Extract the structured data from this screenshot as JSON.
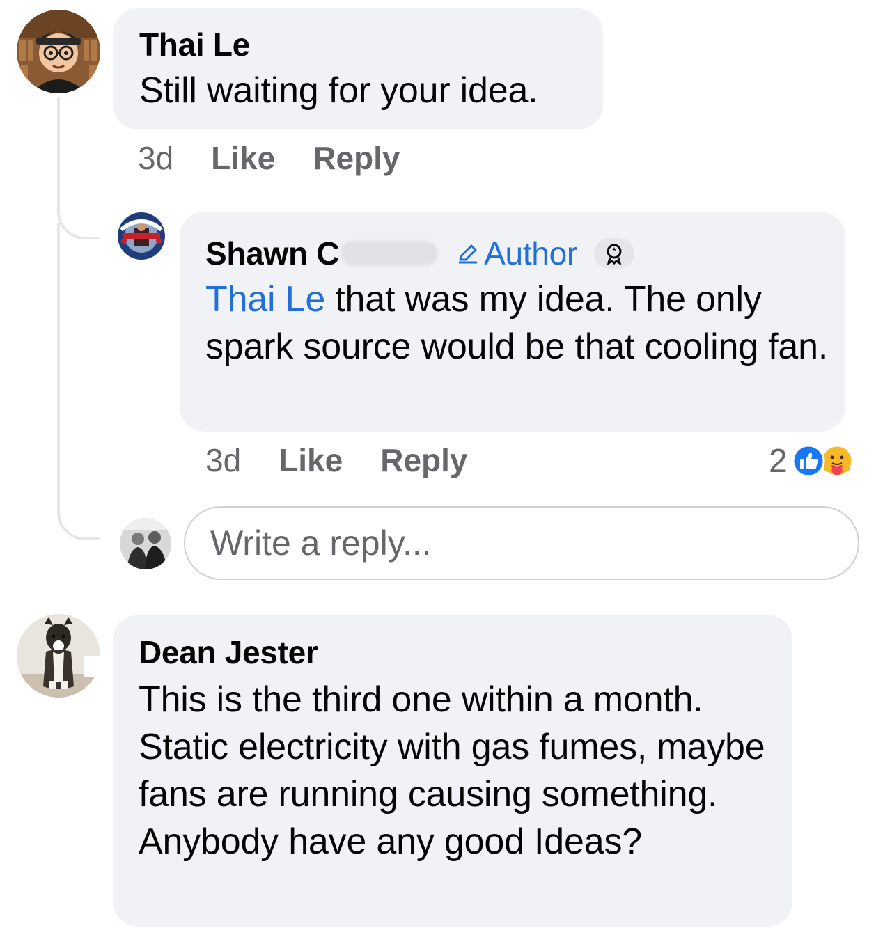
{
  "comments": [
    {
      "author": "Thai Le",
      "text": "Still waiting for your idea.",
      "time": "3d",
      "like": "Like",
      "reply": "Reply"
    },
    {
      "author": "Shawn C",
      "badge": "Author",
      "mention": "Thai Le",
      "text_after_mention": " that was my idea. The only spark source would be that cooling fan.",
      "time": "3d",
      "like": "Like",
      "reply": "Reply",
      "reaction_count": "2",
      "reactions": [
        "like-icon",
        "care-icon"
      ]
    },
    {
      "author": "Dean Jester",
      "text": "This is the third one within a month. Static electricity with gas fumes, maybe fans are running causing something. Anybody have any good Ideas?"
    }
  ],
  "reply_box": {
    "placeholder": "Write a reply..."
  },
  "colors": {
    "bubble": "#f0f2f5",
    "link": "#216fdb",
    "secondary_text": "#65676b",
    "like_blue": "#1877f2"
  }
}
